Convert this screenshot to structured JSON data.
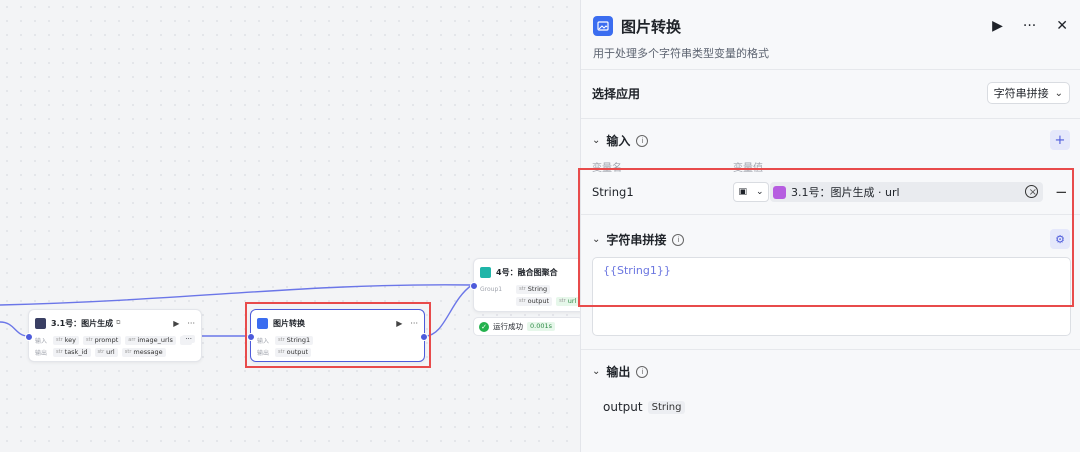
{
  "canvas": {
    "node_image_gen": {
      "title": "3.1号：图片生成",
      "input_label": "输入",
      "inputs": [
        "key",
        "prompt",
        "image_urls",
        "..."
      ],
      "output_label": "输出",
      "outputs": [
        "task_id",
        "url",
        "message"
      ]
    },
    "node_convert": {
      "title": "图片转换",
      "input_label": "输入",
      "input": "String1",
      "output_label": "输出",
      "output": "output"
    },
    "node_fusion": {
      "title": "4号：融合图聚合",
      "group_label": "Group1",
      "field1": "String",
      "field2": "output",
      "field3": "url"
    },
    "status": {
      "text": "运行成功",
      "time": "0.001s"
    }
  },
  "panel": {
    "title": "图片转换",
    "description": "用于处理多个字符串类型变量的格式",
    "select_app_label": "选择应用",
    "select_app_value": "字符串拼接",
    "input_section": "输入",
    "col_var_name": "变量名",
    "col_var_value": "变量值",
    "var_name": "String1",
    "ref_value": "3.1号：图片生成 · url",
    "concat_section": "字符串拼接",
    "template": "{{String1}}",
    "output_section": "输出",
    "output_name": "output",
    "output_type": "String"
  }
}
